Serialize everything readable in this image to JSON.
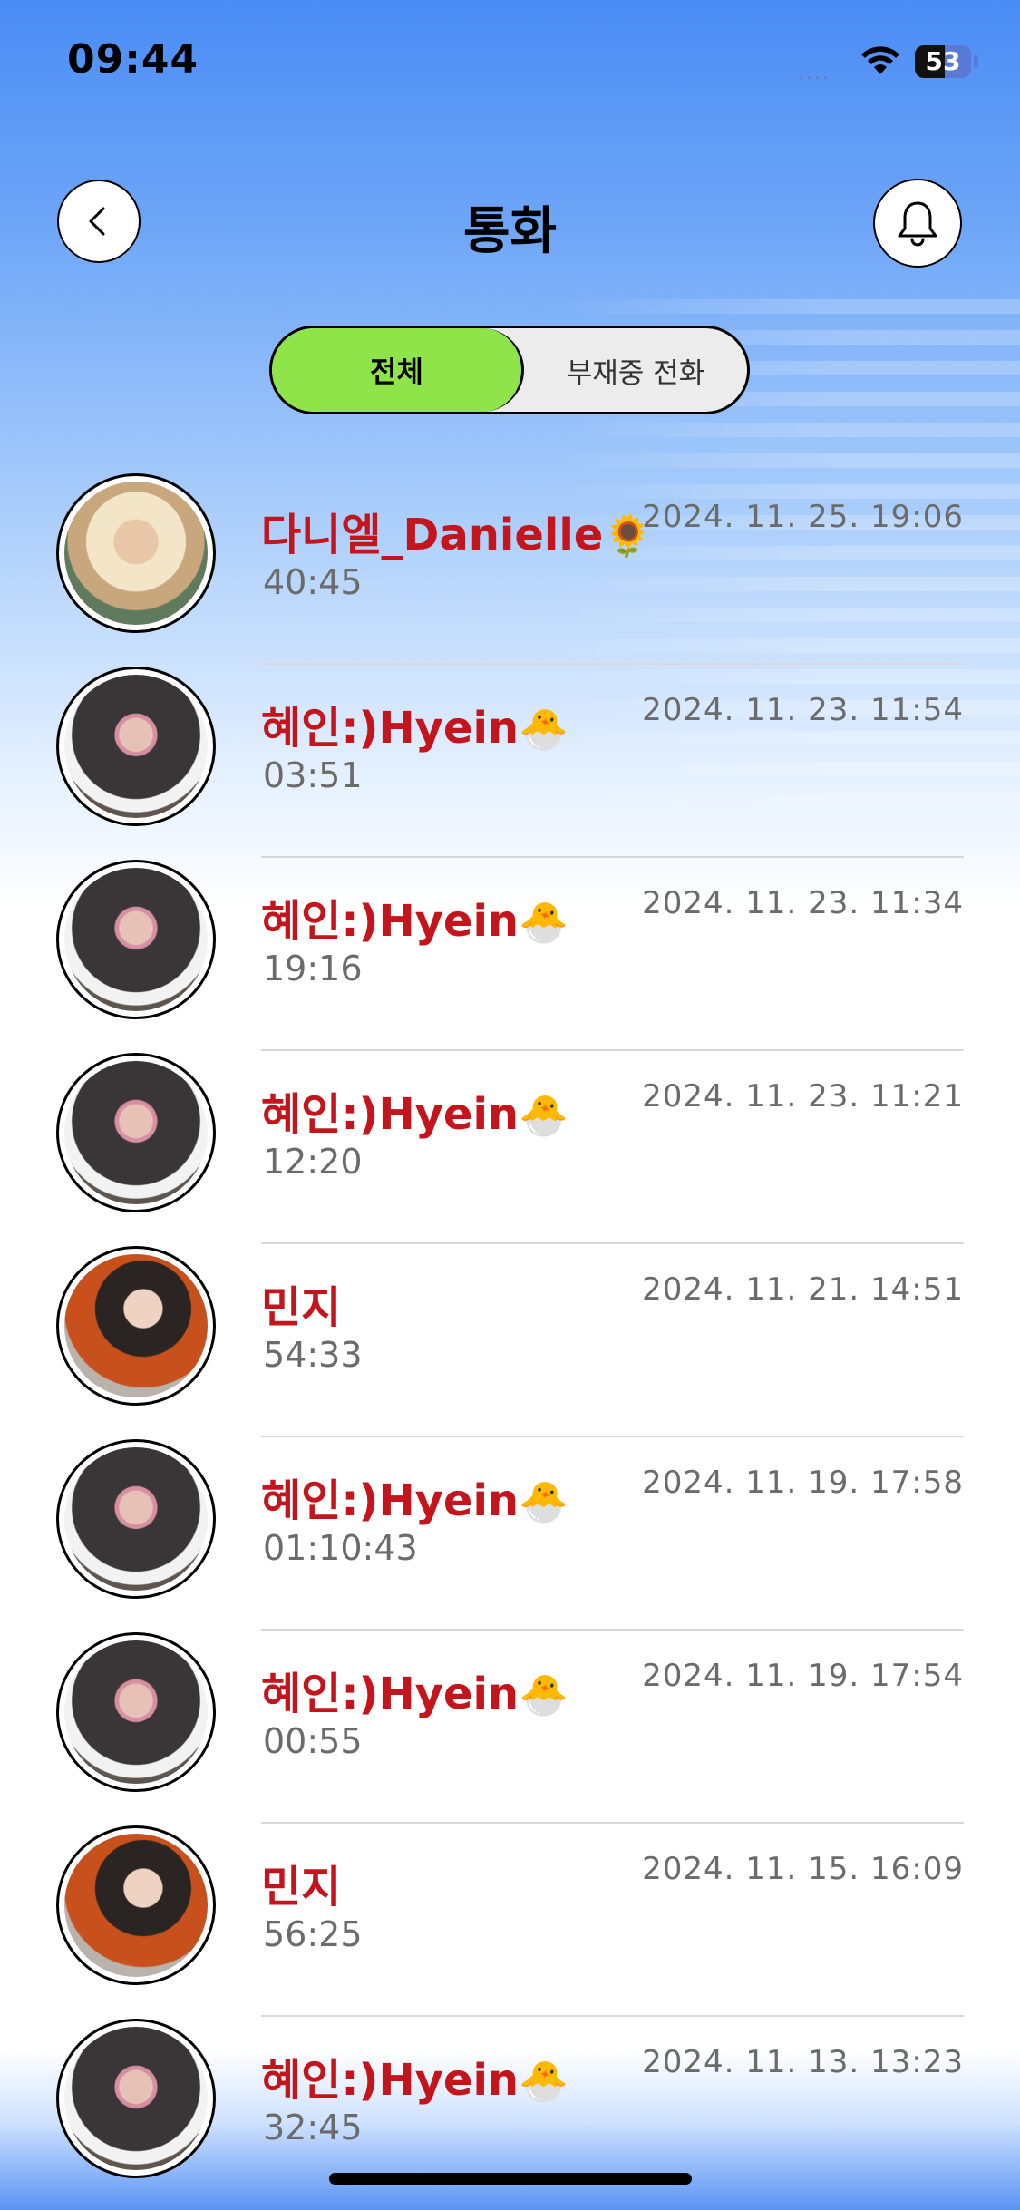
{
  "status_bar": {
    "time": "09:44",
    "signal": "....",
    "battery": "53",
    "battery_level": 0.53
  },
  "header": {
    "title": "통화",
    "back_icon": "chevron-left-icon",
    "bell_icon": "bell-icon"
  },
  "tabs": [
    {
      "label": "전체",
      "active": true
    },
    {
      "label": "부재중 전화",
      "active": false
    }
  ],
  "colors": {
    "accent_green": "#8fe44a",
    "name_red": "#c3151b",
    "gradient_top": "#4a8cf5"
  },
  "calls": [
    {
      "name": "다니엘_Danielle",
      "emoji": "🌻",
      "duration": "40:45",
      "date": "2024. 11. 25. 19:06",
      "avatar": "danielle"
    },
    {
      "name": "혜인:)Hyein",
      "emoji": "🐣",
      "duration": "03:51",
      "date": "2024. 11. 23. 11:54",
      "avatar": "hyein"
    },
    {
      "name": "혜인:)Hyein",
      "emoji": "🐣",
      "duration": "19:16",
      "date": "2024. 11. 23. 11:34",
      "avatar": "hyein"
    },
    {
      "name": "혜인:)Hyein",
      "emoji": "🐣",
      "duration": "12:20",
      "date": "2024. 11. 23. 11:21",
      "avatar": "hyein"
    },
    {
      "name": "민지",
      "emoji": "",
      "duration": "54:33",
      "date": "2024. 11. 21. 14:51",
      "avatar": "minji"
    },
    {
      "name": "혜인:)Hyein",
      "emoji": "🐣",
      "duration": "01:10:43",
      "date": "2024. 11. 19. 17:58",
      "avatar": "hyein"
    },
    {
      "name": "혜인:)Hyein",
      "emoji": "🐣",
      "duration": "00:55",
      "date": "2024. 11. 19. 17:54",
      "avatar": "hyein"
    },
    {
      "name": "민지",
      "emoji": "",
      "duration": "56:25",
      "date": "2024. 11. 15. 16:09",
      "avatar": "minji"
    },
    {
      "name": "혜인:)Hyein",
      "emoji": "🐣",
      "duration": "32:45",
      "date": "2024. 11. 13. 13:23",
      "avatar": "hyein"
    }
  ]
}
